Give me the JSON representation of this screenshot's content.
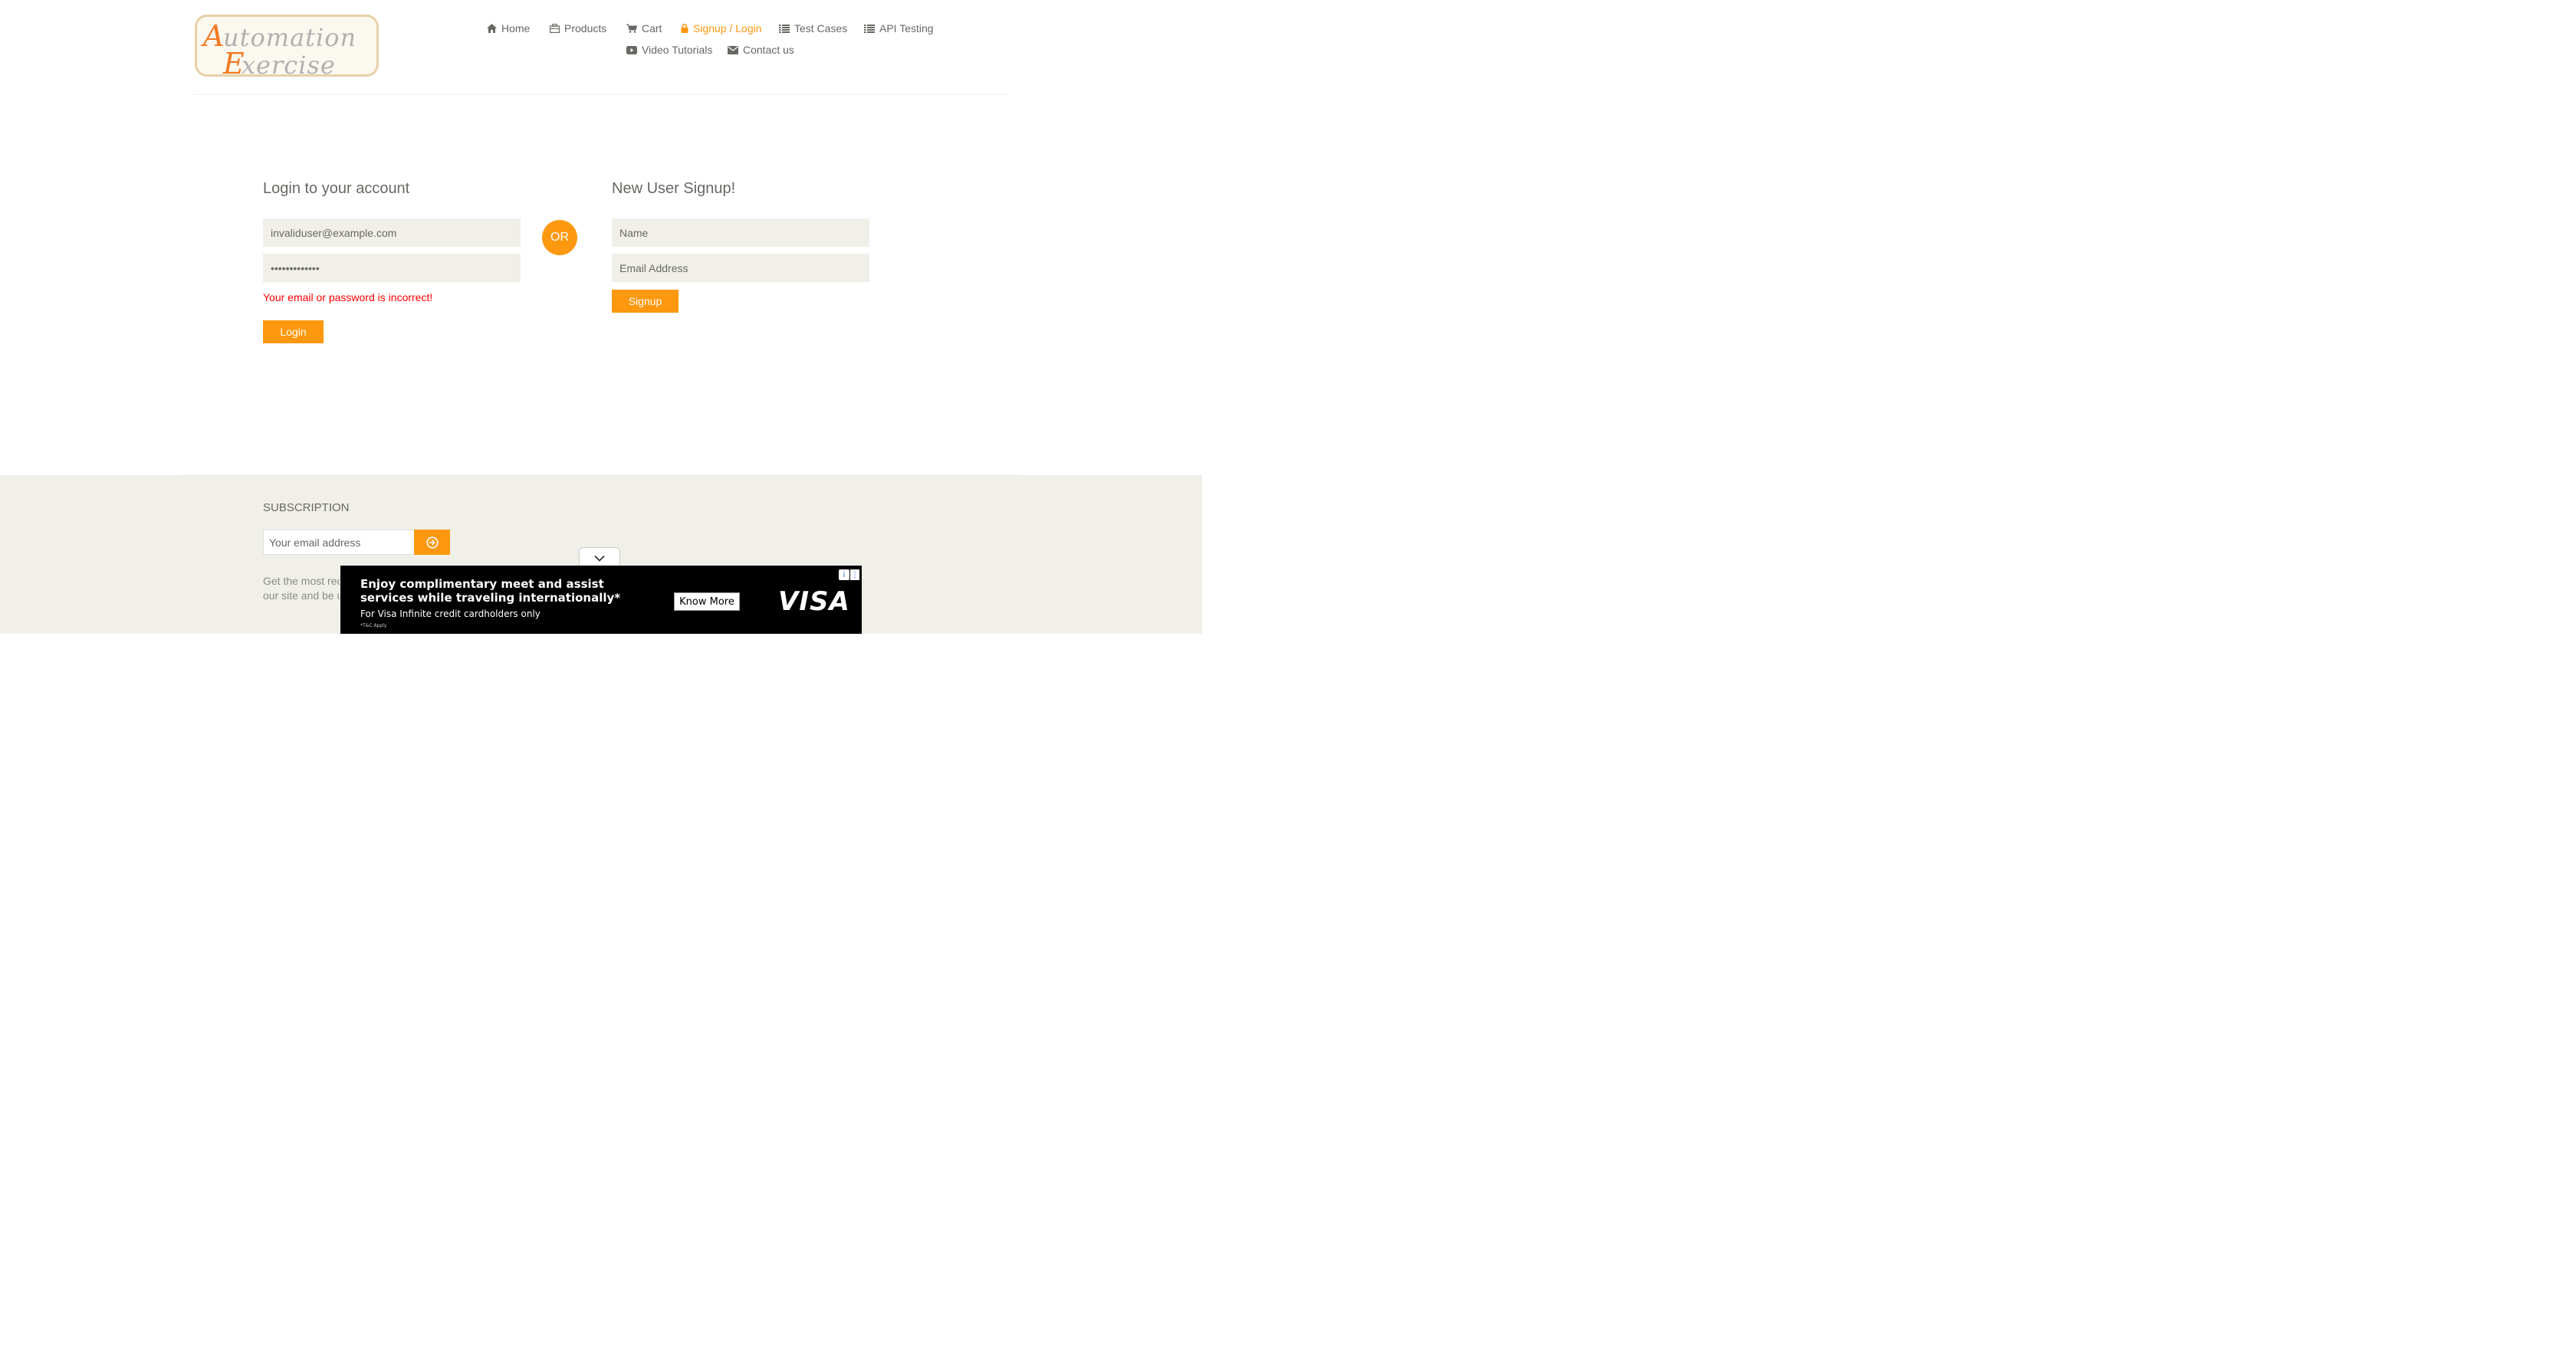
{
  "brand": {
    "logo_line1": "Automation",
    "logo_line2": "Exercise"
  },
  "nav": {
    "items": [
      {
        "label": "Home",
        "icon": "home-icon"
      },
      {
        "label": "Products",
        "icon": "briefcase-icon"
      },
      {
        "label": "Cart",
        "icon": "cart-icon"
      },
      {
        "label": "Signup / Login",
        "icon": "lock-icon",
        "active": true
      },
      {
        "label": "Test Cases",
        "icon": "list-icon"
      },
      {
        "label": "API Testing",
        "icon": "list-icon"
      },
      {
        "label": "Video Tutorials",
        "icon": "youtube-play-icon"
      },
      {
        "label": "Contact us",
        "icon": "envelope-icon"
      }
    ]
  },
  "login": {
    "title": "Login to your account",
    "email_value": "invaliduser@example.com",
    "password_value": "wrongpassword",
    "error": "Your email or password is incorrect!",
    "button": "Login"
  },
  "divider": {
    "label": "OR"
  },
  "signup": {
    "title": "New User Signup!",
    "name_placeholder": "Name",
    "email_placeholder": "Email Address",
    "button": "Signup"
  },
  "footer": {
    "subscription_title": "SUBSCRIPTION",
    "email_placeholder": "Your email address",
    "subscribe_icon": "arrow-circle-right-icon",
    "text_line1": "Get the most rece",
    "text_line2": "our site and be up"
  },
  "ad": {
    "headline": "Enjoy complimentary meet and assist services while traveling internationally*",
    "subline": "For Visa Infinite credit cardholders only",
    "fineprint": "*T&C Apply",
    "cta": "Know More",
    "brand": "VISA",
    "info_glyph": "i",
    "menu_glyph": "⋮"
  },
  "colors": {
    "accent": "#fe980f",
    "text": "#696763",
    "error": "#ff0000",
    "input_bg": "#f0f0e9",
    "footer_bg": "#f0f0e9"
  }
}
